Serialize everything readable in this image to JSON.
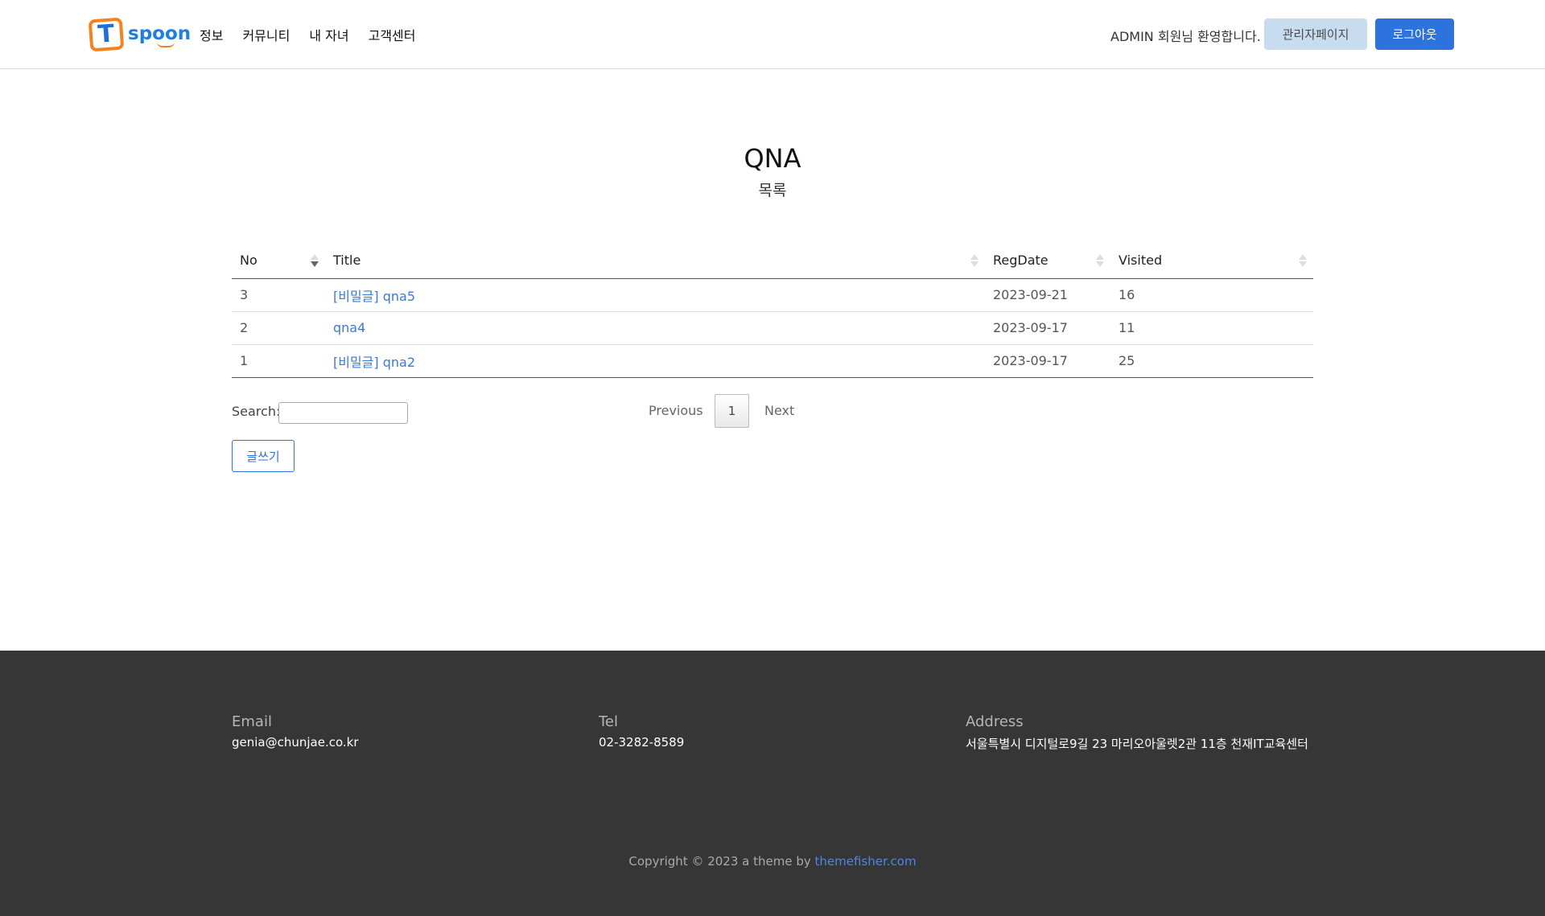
{
  "header": {
    "logo_letter": "T",
    "logo_text": "spoon",
    "nav": [
      "정보",
      "커뮤니티",
      "내 자녀",
      "고객센터"
    ],
    "welcome": "ADMIN 회원님 환영합니다.",
    "admin_button": "관리자페이지",
    "logout_button": "로그아웃"
  },
  "page": {
    "title": "QNA",
    "subtitle": "목록"
  },
  "table": {
    "columns": [
      "No",
      "Title",
      "RegDate",
      "Visited"
    ],
    "rows": [
      {
        "no": "3",
        "title": "[비밀글] qna5",
        "regdate": "2023-09-21",
        "visited": "16"
      },
      {
        "no": "2",
        "title": "qna4",
        "regdate": "2023-09-17",
        "visited": "11"
      },
      {
        "no": "1",
        "title": "[비밀글] qna2",
        "regdate": "2023-09-17",
        "visited": "25"
      }
    ]
  },
  "controls": {
    "search_label": "Search:",
    "search_value": "",
    "previous": "Previous",
    "current_page": "1",
    "next": "Next",
    "write_button": "글쓰기"
  },
  "footer": {
    "email_label": "Email",
    "email_value": "genia@chunjae.co.kr",
    "tel_label": "Tel",
    "tel_value": "02-3282-8589",
    "address_label": "Address",
    "address_value": "서울특별시 디지털로9길 23 마리오아울렛2관 11층 천재IT교육센터",
    "copyright_text": "Copyright © 2023 a theme by",
    "copyright_link": "themefisher.com"
  }
}
